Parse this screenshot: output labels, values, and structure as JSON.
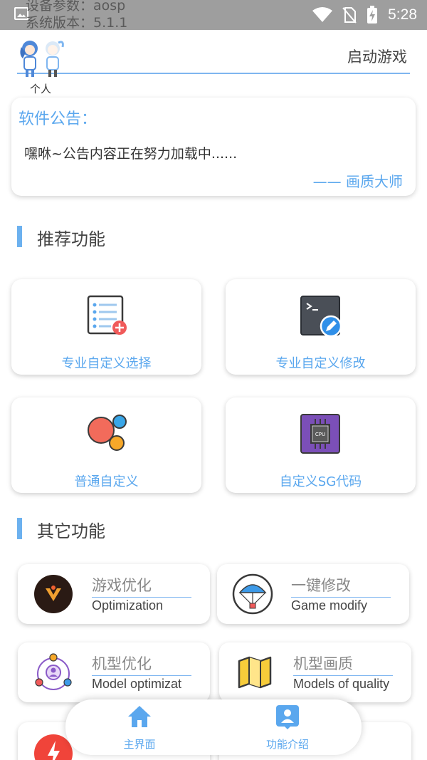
{
  "status_bar": {
    "debug_line1": "设备参数：aosp",
    "debug_line2": "系统版本：5.1.1",
    "time": "5:28"
  },
  "header": {
    "launch_button": "启动游戏",
    "avatar_label": "个人"
  },
  "notice": {
    "title": "软件公告：",
    "body": "嘿咻~公告内容正在努力加载中......",
    "signature": "—— 画质大师"
  },
  "recommended": {
    "title": "推荐功能",
    "cards": [
      {
        "label": "专业自定义选择",
        "icon": "list-add-icon"
      },
      {
        "label": "专业自定义修改",
        "icon": "terminal-edit-icon"
      },
      {
        "label": "普通自定义",
        "icon": "bubbles-icon"
      },
      {
        "label": "自定义SG代码",
        "icon": "cpu-icon"
      }
    ]
  },
  "other": {
    "title": "其它功能",
    "items": [
      {
        "title": "游戏优化",
        "subtitle": "Optimization",
        "icon": "logo-v-icon"
      },
      {
        "title": "一键修改",
        "subtitle": "Game modify",
        "icon": "parachute-icon"
      },
      {
        "title": "机型优化",
        "subtitle": "Model optimizat",
        "icon": "user-network-icon"
      },
      {
        "title": "机型画质",
        "subtitle": "Models of quality",
        "icon": "map-icon"
      }
    ]
  },
  "bottom_nav": {
    "items": [
      {
        "label": "主界面",
        "icon": "home-icon"
      },
      {
        "label": "功能介绍",
        "icon": "profile-card-icon"
      }
    ]
  },
  "colors": {
    "accent": "#5aa7ee",
    "status_bar": "#9e9e9e"
  }
}
